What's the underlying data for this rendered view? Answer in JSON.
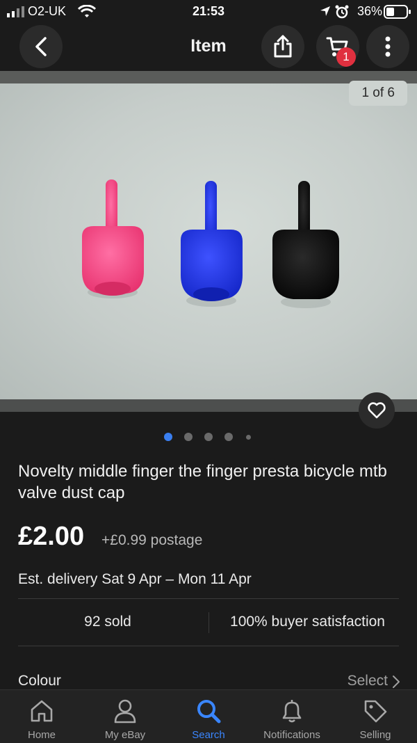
{
  "status_bar": {
    "carrier": "O2-UK",
    "time": "21:53",
    "battery_percent": "36%"
  },
  "nav": {
    "title": "Item",
    "cart_count": "1"
  },
  "gallery": {
    "counter": "1 of 6",
    "active_index": 0,
    "dot_count": 5
  },
  "item": {
    "title": "Novelty middle finger the finger presta bicycle mtb valve dust cap",
    "price": "£2.00",
    "postage": "+£0.99 postage",
    "delivery": "Est. delivery Sat 9 Apr – Mon 11 Apr",
    "sold": "92 sold",
    "satisfaction": "100% buyer satisfaction"
  },
  "variation": {
    "label": "Colour",
    "action": "Select"
  },
  "tabs": [
    {
      "label": "Home",
      "icon": "home-icon"
    },
    {
      "label": "My eBay",
      "icon": "person-icon"
    },
    {
      "label": "Search",
      "icon": "search-icon"
    },
    {
      "label": "Notifications",
      "icon": "bell-icon"
    },
    {
      "label": "Selling",
      "icon": "tag-icon"
    }
  ],
  "colors": {
    "background": "#1b1b1b",
    "accent": "#3a86ff",
    "badge": "#e0303f"
  }
}
